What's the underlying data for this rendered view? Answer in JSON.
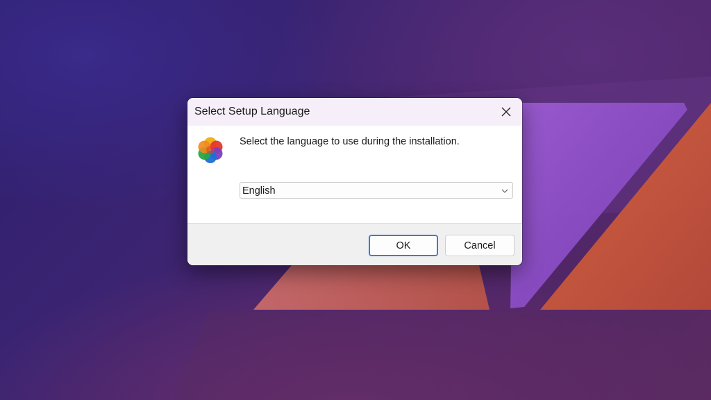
{
  "dialog": {
    "title": "Select Setup Language",
    "prompt": "Select the language to use during the installation.",
    "language_select": {
      "selected": "English"
    },
    "buttons": {
      "ok_label": "OK",
      "cancel_label": "Cancel"
    }
  },
  "icons": {
    "close": "close-icon",
    "app": "setup-app-icon",
    "dropdown": "chevron-down-icon"
  },
  "colors": {
    "default_button_border": "#3a7bd5",
    "title_bar": "#f6eef8",
    "footer": "#f0f0f0"
  }
}
